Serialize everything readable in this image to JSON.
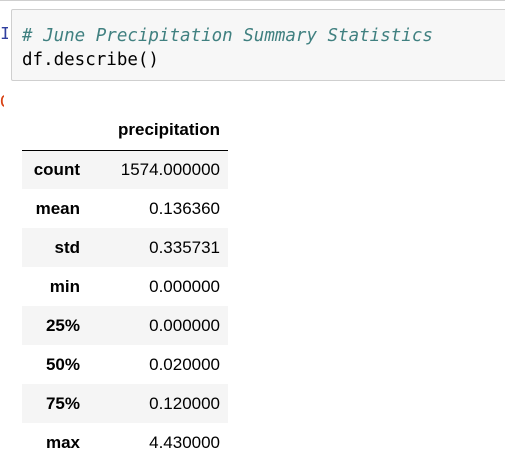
{
  "input_cell": {
    "prompt": "In [",
    "comment": "# June Precipitation Summary Statistics",
    "code": "df.describe()"
  },
  "output_cell": {
    "prompt": "Out["
  },
  "dataframe": {
    "columns": [
      "precipitation"
    ],
    "rows": [
      {
        "label": "count",
        "value": "1574.000000"
      },
      {
        "label": "mean",
        "value": "0.136360"
      },
      {
        "label": "std",
        "value": "0.335731"
      },
      {
        "label": "min",
        "value": "0.000000"
      },
      {
        "label": "25%",
        "value": "0.000000"
      },
      {
        "label": "50%",
        "value": "0.020000"
      },
      {
        "label": "75%",
        "value": "0.120000"
      },
      {
        "label": "max",
        "value": "4.430000"
      }
    ]
  },
  "colors": {
    "comment": "#408080",
    "in_prompt": "#303f9f",
    "out_prompt": "#d84315",
    "input_background": "#f7f7f7",
    "row_stripe": "#f5f5f5"
  }
}
